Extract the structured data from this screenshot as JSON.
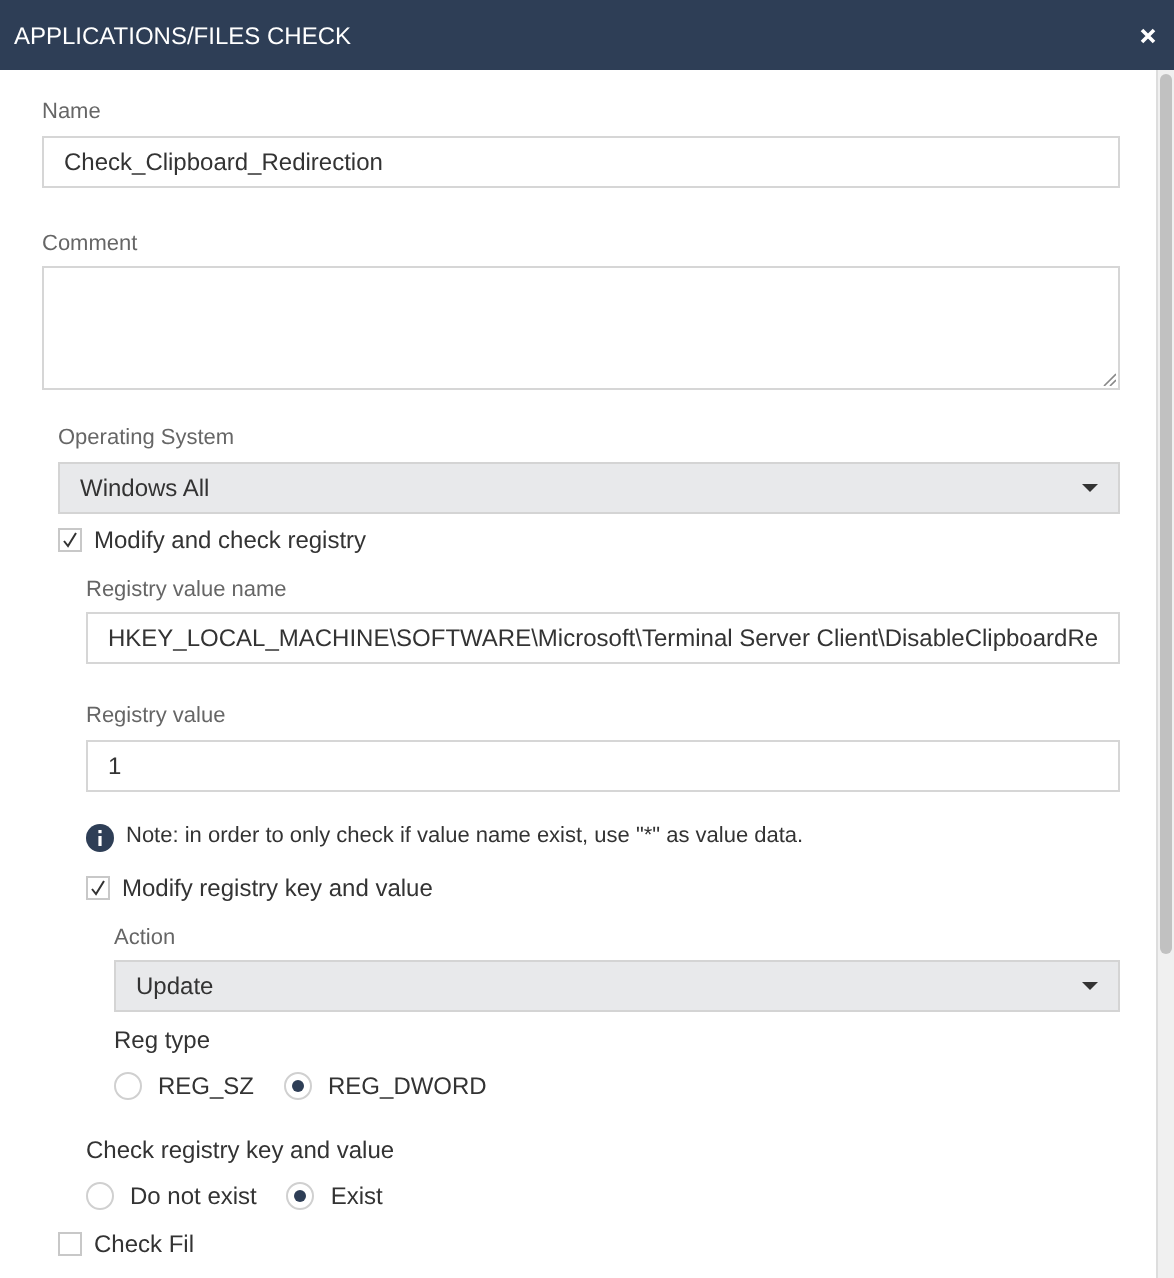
{
  "window": {
    "title": "APPLICATIONS/FILES CHECK"
  },
  "name_field": {
    "label": "Name",
    "value": "Check_Clipboard_Redirection"
  },
  "comment_field": {
    "label": "Comment"
  },
  "operating_system": {
    "label": "Operating System",
    "value": "Windows All"
  },
  "modify_check_registry": {
    "label": "Modify and check registry",
    "checked": true
  },
  "registry_value_name": {
    "label": "Registry value name",
    "value": "HKEY_LOCAL_MACHINE\\SOFTWARE\\Microsoft\\Terminal Server Client\\DisableClipboardRe"
  },
  "registry_value": {
    "label": "Registry value",
    "value": "1"
  },
  "note": "Note: in order to only check if value name exist, use \"*\" as value data.",
  "modify_registry_key": {
    "label": "Modify registry key and value",
    "checked": true
  },
  "action": {
    "label": "Action",
    "value": "Update"
  },
  "reg_type": {
    "label": "Reg type",
    "options": [
      {
        "label": "REG_SZ",
        "selected": false
      },
      {
        "label": "REG_DWORD",
        "selected": true
      }
    ]
  },
  "check_registry": {
    "label": "Check registry key and value",
    "options": [
      {
        "label": "Do not exist",
        "selected": false
      },
      {
        "label": "Exist",
        "selected": true
      }
    ]
  },
  "check_file": {
    "label": "Check Fil",
    "checked": false
  }
}
